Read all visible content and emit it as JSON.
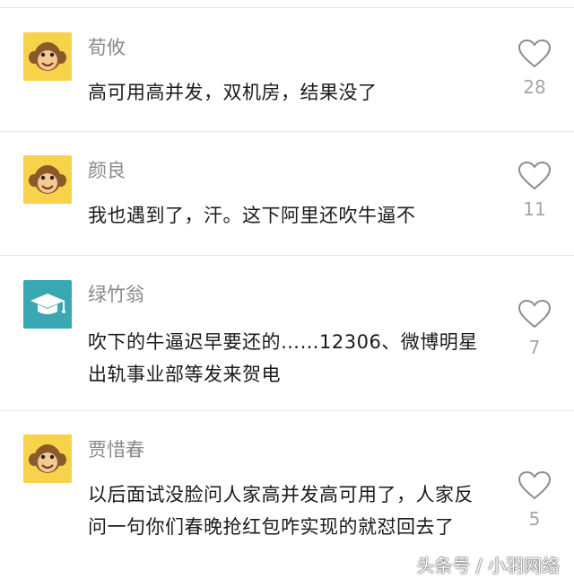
{
  "colors": {
    "username": "#8a8a8a",
    "text": "#1a1a1a",
    "like_count": "#a6a6a6",
    "divider": "#e6e6e6",
    "avatar_monkey_bg": "#f7d24a",
    "avatar_cap_bg": "#3aa8b3"
  },
  "comments": [
    {
      "user": "荀攸",
      "avatar": "monkey-icon",
      "text": "高可用高并发，双机房，结果没了",
      "likes": "28"
    },
    {
      "user": "颜良",
      "avatar": "monkey-icon",
      "text": "我也遇到了，汗。这下阿里还吹牛逼不",
      "likes": "11"
    },
    {
      "user": "绿竹翁",
      "avatar": "graduation-cap-icon",
      "text": "吹下的牛逼迟早要还的……12306、微博明星出轨事业部等发来贺电",
      "likes": "7"
    },
    {
      "user": "贾惜春",
      "avatar": "monkey-icon",
      "text": "以后面试没脸问人家高并发高可用了，人家反问一句你们春晚抢红包咋实现的就怼回去了",
      "likes": "5"
    }
  ],
  "watermark": "头条号 / 小羽网络"
}
